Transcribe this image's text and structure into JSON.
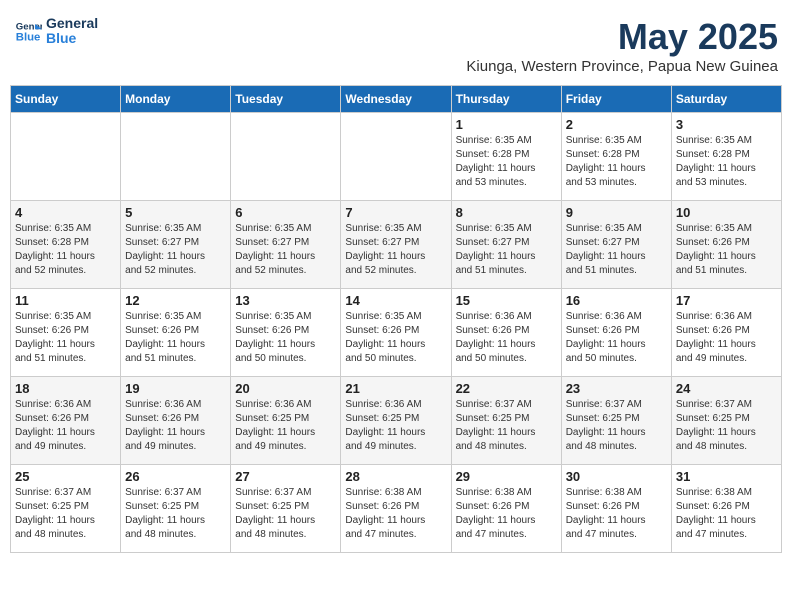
{
  "logo": {
    "line1": "General",
    "line2": "Blue"
  },
  "title": "May 2025",
  "location": "Kiunga, Western Province, Papua New Guinea",
  "days_of_week": [
    "Sunday",
    "Monday",
    "Tuesday",
    "Wednesday",
    "Thursday",
    "Friday",
    "Saturday"
  ],
  "weeks": [
    [
      {
        "day": "",
        "info": ""
      },
      {
        "day": "",
        "info": ""
      },
      {
        "day": "",
        "info": ""
      },
      {
        "day": "",
        "info": ""
      },
      {
        "day": "1",
        "info": "Sunrise: 6:35 AM\nSunset: 6:28 PM\nDaylight: 11 hours\nand 53 minutes."
      },
      {
        "day": "2",
        "info": "Sunrise: 6:35 AM\nSunset: 6:28 PM\nDaylight: 11 hours\nand 53 minutes."
      },
      {
        "day": "3",
        "info": "Sunrise: 6:35 AM\nSunset: 6:28 PM\nDaylight: 11 hours\nand 53 minutes."
      }
    ],
    [
      {
        "day": "4",
        "info": "Sunrise: 6:35 AM\nSunset: 6:28 PM\nDaylight: 11 hours\nand 52 minutes."
      },
      {
        "day": "5",
        "info": "Sunrise: 6:35 AM\nSunset: 6:27 PM\nDaylight: 11 hours\nand 52 minutes."
      },
      {
        "day": "6",
        "info": "Sunrise: 6:35 AM\nSunset: 6:27 PM\nDaylight: 11 hours\nand 52 minutes."
      },
      {
        "day": "7",
        "info": "Sunrise: 6:35 AM\nSunset: 6:27 PM\nDaylight: 11 hours\nand 52 minutes."
      },
      {
        "day": "8",
        "info": "Sunrise: 6:35 AM\nSunset: 6:27 PM\nDaylight: 11 hours\nand 51 minutes."
      },
      {
        "day": "9",
        "info": "Sunrise: 6:35 AM\nSunset: 6:27 PM\nDaylight: 11 hours\nand 51 minutes."
      },
      {
        "day": "10",
        "info": "Sunrise: 6:35 AM\nSunset: 6:26 PM\nDaylight: 11 hours\nand 51 minutes."
      }
    ],
    [
      {
        "day": "11",
        "info": "Sunrise: 6:35 AM\nSunset: 6:26 PM\nDaylight: 11 hours\nand 51 minutes."
      },
      {
        "day": "12",
        "info": "Sunrise: 6:35 AM\nSunset: 6:26 PM\nDaylight: 11 hours\nand 51 minutes."
      },
      {
        "day": "13",
        "info": "Sunrise: 6:35 AM\nSunset: 6:26 PM\nDaylight: 11 hours\nand 50 minutes."
      },
      {
        "day": "14",
        "info": "Sunrise: 6:35 AM\nSunset: 6:26 PM\nDaylight: 11 hours\nand 50 minutes."
      },
      {
        "day": "15",
        "info": "Sunrise: 6:36 AM\nSunset: 6:26 PM\nDaylight: 11 hours\nand 50 minutes."
      },
      {
        "day": "16",
        "info": "Sunrise: 6:36 AM\nSunset: 6:26 PM\nDaylight: 11 hours\nand 50 minutes."
      },
      {
        "day": "17",
        "info": "Sunrise: 6:36 AM\nSunset: 6:26 PM\nDaylight: 11 hours\nand 49 minutes."
      }
    ],
    [
      {
        "day": "18",
        "info": "Sunrise: 6:36 AM\nSunset: 6:26 PM\nDaylight: 11 hours\nand 49 minutes."
      },
      {
        "day": "19",
        "info": "Sunrise: 6:36 AM\nSunset: 6:26 PM\nDaylight: 11 hours\nand 49 minutes."
      },
      {
        "day": "20",
        "info": "Sunrise: 6:36 AM\nSunset: 6:25 PM\nDaylight: 11 hours\nand 49 minutes."
      },
      {
        "day": "21",
        "info": "Sunrise: 6:36 AM\nSunset: 6:25 PM\nDaylight: 11 hours\nand 49 minutes."
      },
      {
        "day": "22",
        "info": "Sunrise: 6:37 AM\nSunset: 6:25 PM\nDaylight: 11 hours\nand 48 minutes."
      },
      {
        "day": "23",
        "info": "Sunrise: 6:37 AM\nSunset: 6:25 PM\nDaylight: 11 hours\nand 48 minutes."
      },
      {
        "day": "24",
        "info": "Sunrise: 6:37 AM\nSunset: 6:25 PM\nDaylight: 11 hours\nand 48 minutes."
      }
    ],
    [
      {
        "day": "25",
        "info": "Sunrise: 6:37 AM\nSunset: 6:25 PM\nDaylight: 11 hours\nand 48 minutes."
      },
      {
        "day": "26",
        "info": "Sunrise: 6:37 AM\nSunset: 6:25 PM\nDaylight: 11 hours\nand 48 minutes."
      },
      {
        "day": "27",
        "info": "Sunrise: 6:37 AM\nSunset: 6:25 PM\nDaylight: 11 hours\nand 48 minutes."
      },
      {
        "day": "28",
        "info": "Sunrise: 6:38 AM\nSunset: 6:26 PM\nDaylight: 11 hours\nand 47 minutes."
      },
      {
        "day": "29",
        "info": "Sunrise: 6:38 AM\nSunset: 6:26 PM\nDaylight: 11 hours\nand 47 minutes."
      },
      {
        "day": "30",
        "info": "Sunrise: 6:38 AM\nSunset: 6:26 PM\nDaylight: 11 hours\nand 47 minutes."
      },
      {
        "day": "31",
        "info": "Sunrise: 6:38 AM\nSunset: 6:26 PM\nDaylight: 11 hours\nand 47 minutes."
      }
    ]
  ]
}
